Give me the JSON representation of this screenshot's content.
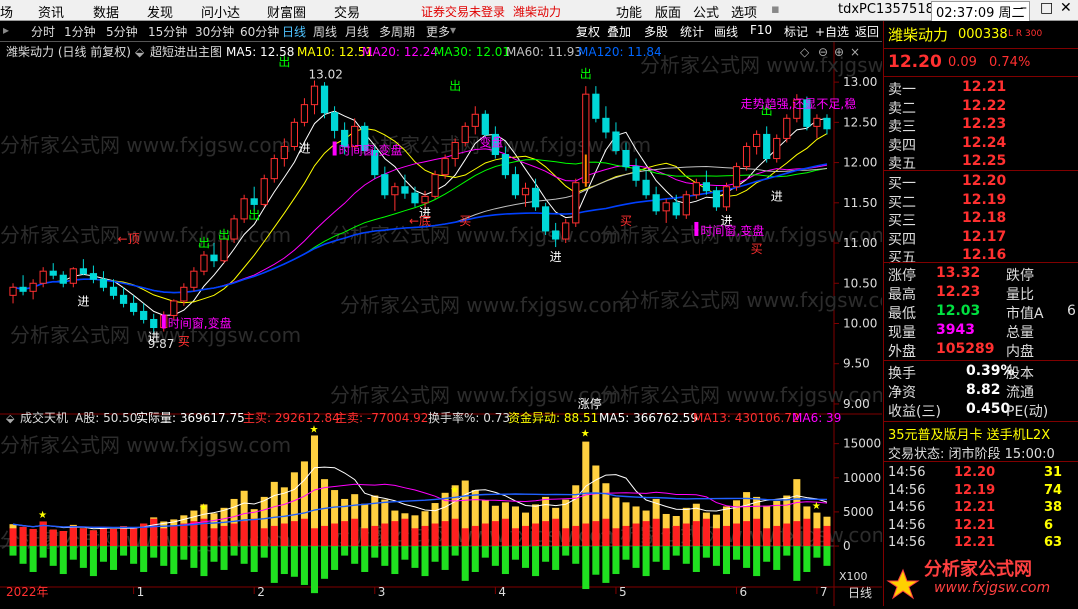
{
  "menubar": {
    "items": [
      "场",
      "资讯",
      "数据",
      "发现",
      "问小达",
      "财富圈",
      "交易"
    ],
    "warnings": [
      "证券交易未登录",
      "潍柴动力"
    ],
    "right_items": [
      "功能",
      "版面",
      "公式",
      "选项"
    ],
    "user": "tdxPC1357518",
    "clock": "02:37:09 周二"
  },
  "toolbar": {
    "periods": [
      "分时",
      "1分钟",
      "5分钟",
      "15分钟",
      "30分钟",
      "60分钟",
      "日线",
      "周线",
      "月线",
      "多周期",
      "更多"
    ],
    "active_period": "日线",
    "buttons": [
      "复权",
      "叠加",
      "多股",
      "统计",
      "画线",
      "F10",
      "标记",
      "+自选",
      "返回"
    ]
  },
  "main_legend": {
    "stock": "潍柴动力 (日线 前复权)",
    "formula": "超短进出主图",
    "ma5": "MA5: 12.58",
    "ma10": "MA10: 12.51",
    "ma20": "MA20: 12.24",
    "ma30": "MA30: 12.01",
    "ma60": "MA60: 11.93",
    "ma120": "MA120: 11.84"
  },
  "price_axis": [
    "13.00",
    "12.50",
    "12.00",
    "11.50",
    "11.00",
    "10.50",
    "10.00",
    "9.50",
    "9.00"
  ],
  "annotations": {
    "high": "13.02",
    "low": "9.87",
    "zhangting": "涨停",
    "labels": [
      "←顶",
      "出",
      "进",
      "买",
      "←底",
      "变盘",
      "时间窗,变盘",
      "走势趋强,还显不足,稳"
    ]
  },
  "sub_legend": {
    "name": "成交天机",
    "a_shares": "A股: 50.50",
    "actual": "实际量: 369617.75",
    "buy": "主买: 292612.84",
    "sell": "主卖: -77004.92",
    "turnover": "换手率%: 0.73",
    "fund": "资金异动: 88.51",
    "ma5": "MA5: 366762.59",
    "ma13": "MA13: 430106.72",
    "ma6": "MA6: 39"
  },
  "volume_axis": [
    "15000",
    "10000",
    "5000",
    "0"
  ],
  "x_axis": {
    "year": "2022年",
    "months": [
      "1",
      "2",
      "3",
      "4",
      "5",
      "6",
      "7"
    ],
    "zoom": "X100",
    "period": "日线"
  },
  "watermark": "分析家公式网 www.fxjgsw.com",
  "colors": {
    "up": "#ff3030",
    "down": "#00d8d8",
    "ma5": "#ffffff",
    "ma10": "#ffff00",
    "ma20": "#ff00ff",
    "ma30": "#00ff00",
    "ma60": "#c0c0c0",
    "ma120": "#0040ff"
  },
  "quote": {
    "name": "潍柴动力",
    "code": "000338",
    "flags": "L R 300",
    "price": "12.20",
    "change": "0.09",
    "pct": "0.74%",
    "sell": [
      {
        "label": "卖五",
        "price": "12.25"
      },
      {
        "label": "卖四",
        "price": "12.24"
      },
      {
        "label": "卖三",
        "price": "12.23"
      },
      {
        "label": "卖二",
        "price": "12.22"
      },
      {
        "label": "卖一",
        "price": "12.21"
      }
    ],
    "buy": [
      {
        "label": "买一",
        "price": "12.20"
      },
      {
        "label": "买二",
        "price": "12.19"
      },
      {
        "label": "买三",
        "price": "12.18"
      },
      {
        "label": "买四",
        "price": "12.17"
      },
      {
        "label": "买五",
        "price": "12.16"
      }
    ],
    "stats": [
      {
        "l1": "涨停",
        "v1": "13.32",
        "l2": "跌停",
        "v2": ""
      },
      {
        "l1": "最高",
        "v1": "12.23",
        "l2": "量比",
        "v2": ""
      },
      {
        "l1": "最低",
        "v1": "12.03",
        "l2": "市值A",
        "v2": "6"
      },
      {
        "l1": "现量",
        "v1": "3943",
        "l2": "总量",
        "v2": ""
      },
      {
        "l1": "外盘",
        "v1": "105289",
        "l2": "内盘",
        "v2": ""
      }
    ],
    "stats2": [
      {
        "l1": "换手",
        "v1": "0.39%",
        "l2": "股本"
      },
      {
        "l1": "净资",
        "v1": "8.82",
        "l2": "流通"
      },
      {
        "l1": "收益(三)",
        "v1": "0.450",
        "l2": "PE(动)"
      }
    ],
    "promo": "35元普及版月卡 送手机L2X",
    "trade_state": "交易状态: 闭市阶段 15:00:0",
    "ticks": [
      {
        "time": "14:56",
        "price": "12.20",
        "vol": "31"
      },
      {
        "time": "14:56",
        "price": "12.19",
        "vol": "74"
      },
      {
        "time": "14:56",
        "price": "12.21",
        "vol": "38"
      },
      {
        "time": "14:56",
        "price": "12.21",
        "vol": "6"
      },
      {
        "time": "14:56",
        "price": "12.21",
        "vol": "63"
      }
    ],
    "logo_text": "分析家公式网",
    "logo_url": "www.fxjgsw.com"
  },
  "chart_data": {
    "type": "candlestick",
    "ylim_price": [
      8.9,
      13.25
    ],
    "ylim_volume": [
      -6000,
      17000
    ],
    "candles": [
      [
        10.35,
        10.5,
        10.25,
        10.45
      ],
      [
        10.45,
        10.6,
        10.35,
        10.4
      ],
      [
        10.4,
        10.55,
        10.3,
        10.5
      ],
      [
        10.5,
        10.7,
        10.45,
        10.65
      ],
      [
        10.65,
        10.75,
        10.55,
        10.6
      ],
      [
        10.6,
        10.65,
        10.45,
        10.5
      ],
      [
        10.5,
        10.7,
        10.45,
        10.68
      ],
      [
        10.68,
        10.8,
        10.6,
        10.62
      ],
      [
        10.62,
        10.72,
        10.5,
        10.55
      ],
      [
        10.55,
        10.65,
        10.4,
        10.45
      ],
      [
        10.45,
        10.55,
        10.3,
        10.35
      ],
      [
        10.35,
        10.45,
        10.2,
        10.25
      ],
      [
        10.25,
        10.35,
        10.1,
        10.15
      ],
      [
        10.15,
        10.25,
        10.0,
        10.05
      ],
      [
        10.05,
        10.12,
        9.87,
        9.95
      ],
      [
        9.95,
        10.15,
        9.9,
        10.1
      ],
      [
        10.1,
        10.3,
        10.05,
        10.28
      ],
      [
        10.28,
        10.5,
        10.22,
        10.45
      ],
      [
        10.45,
        10.7,
        10.4,
        10.65
      ],
      [
        10.65,
        10.9,
        10.6,
        10.85
      ],
      [
        10.85,
        11.0,
        10.7,
        10.78
      ],
      [
        10.78,
        11.1,
        10.75,
        11.05
      ],
      [
        11.05,
        11.35,
        11.0,
        11.3
      ],
      [
        11.3,
        11.6,
        11.25,
        11.55
      ],
      [
        11.55,
        11.7,
        11.4,
        11.48
      ],
      [
        11.48,
        11.85,
        11.45,
        11.8
      ],
      [
        11.8,
        12.1,
        11.75,
        12.05
      ],
      [
        12.05,
        12.3,
        11.95,
        12.2
      ],
      [
        12.2,
        12.55,
        12.15,
        12.5
      ],
      [
        12.5,
        12.8,
        12.45,
        12.72
      ],
      [
        12.72,
        13.02,
        12.6,
        12.95
      ],
      [
        12.95,
        13.0,
        12.55,
        12.62
      ],
      [
        12.62,
        12.7,
        12.3,
        12.4
      ],
      [
        12.4,
        12.5,
        12.1,
        12.2
      ],
      [
        12.2,
        12.55,
        12.15,
        12.45
      ],
      [
        12.45,
        12.5,
        12.1,
        12.15
      ],
      [
        12.15,
        12.2,
        11.8,
        11.85
      ],
      [
        11.85,
        11.95,
        11.55,
        11.6
      ],
      [
        11.6,
        11.75,
        11.4,
        11.7
      ],
      [
        11.7,
        11.85,
        11.55,
        11.62
      ],
      [
        11.62,
        11.7,
        11.45,
        11.5
      ],
      [
        11.5,
        11.65,
        11.38,
        11.58
      ],
      [
        11.58,
        11.9,
        11.55,
        11.85
      ],
      [
        11.85,
        12.1,
        11.8,
        12.05
      ],
      [
        12.05,
        12.3,
        11.95,
        12.25
      ],
      [
        12.25,
        12.5,
        12.2,
        12.45
      ],
      [
        12.45,
        12.7,
        12.35,
        12.6
      ],
      [
        12.6,
        12.65,
        12.3,
        12.35
      ],
      [
        12.35,
        12.45,
        12.05,
        12.1
      ],
      [
        12.1,
        12.2,
        11.8,
        11.85
      ],
      [
        11.85,
        11.95,
        11.55,
        11.6
      ],
      [
        11.6,
        11.75,
        11.45,
        11.68
      ],
      [
        11.68,
        11.8,
        11.4,
        11.45
      ],
      [
        11.45,
        11.5,
        11.1,
        11.15
      ],
      [
        11.15,
        11.25,
        10.95,
        11.05
      ],
      [
        11.05,
        11.3,
        11.0,
        11.25
      ],
      [
        11.25,
        11.8,
        11.2,
        11.75
      ],
      [
        11.75,
        12.95,
        11.7,
        12.85
      ],
      [
        12.85,
        12.95,
        12.5,
        12.55
      ],
      [
        12.55,
        12.7,
        12.3,
        12.38
      ],
      [
        12.38,
        12.5,
        12.1,
        12.15
      ],
      [
        12.15,
        12.25,
        11.9,
        11.95
      ],
      [
        11.95,
        12.05,
        11.7,
        11.78
      ],
      [
        11.78,
        11.9,
        11.55,
        11.6
      ],
      [
        11.6,
        11.7,
        11.35,
        11.4
      ],
      [
        11.4,
        11.55,
        11.25,
        11.5
      ],
      [
        11.5,
        11.6,
        11.3,
        11.35
      ],
      [
        11.35,
        11.65,
        11.3,
        11.6
      ],
      [
        11.6,
        11.8,
        11.55,
        11.75
      ],
      [
        11.75,
        11.9,
        11.6,
        11.65
      ],
      [
        11.65,
        11.7,
        11.4,
        11.45
      ],
      [
        11.45,
        11.75,
        11.4,
        11.7
      ],
      [
        11.7,
        12.0,
        11.65,
        11.95
      ],
      [
        11.95,
        12.25,
        11.9,
        12.2
      ],
      [
        12.2,
        12.4,
        12.1,
        12.35
      ],
      [
        12.35,
        12.45,
        12.0,
        12.05
      ],
      [
        12.05,
        12.35,
        12.0,
        12.3
      ],
      [
        12.3,
        12.6,
        12.25,
        12.55
      ],
      [
        12.55,
        12.85,
        12.5,
        12.78
      ],
      [
        12.78,
        12.82,
        12.4,
        12.45
      ],
      [
        12.45,
        12.6,
        12.3,
        12.55
      ],
      [
        12.55,
        12.6,
        12.35,
        12.42
      ]
    ],
    "volumes": [
      3200,
      2800,
      2500,
      3600,
      2400,
      2200,
      3100,
      2600,
      2300,
      2700,
      2500,
      2900,
      2600,
      3300,
      4200,
      3600,
      3900,
      4500,
      5200,
      6100,
      4800,
      5600,
      6900,
      8100,
      5400,
      7200,
      9400,
      8600,
      10800,
      12400,
      16200,
      9800,
      8200,
      6900,
      7600,
      6200,
      7400,
      6800,
      5200,
      4800,
      4500,
      5100,
      6300,
      7800,
      8900,
      9600,
      8200,
      6700,
      5900,
      6400,
      5800,
      4900,
      6100,
      7200,
      5600,
      6800,
      8900,
      15300,
      11800,
      9200,
      7100,
      6400,
      5800,
      5200,
      6900,
      4700,
      4400,
      5600,
      6200,
      4900,
      4600,
      5800,
      6700,
      7900,
      7200,
      5900,
      6600,
      7400,
      9800,
      5800,
      4900,
      4300
    ]
  }
}
